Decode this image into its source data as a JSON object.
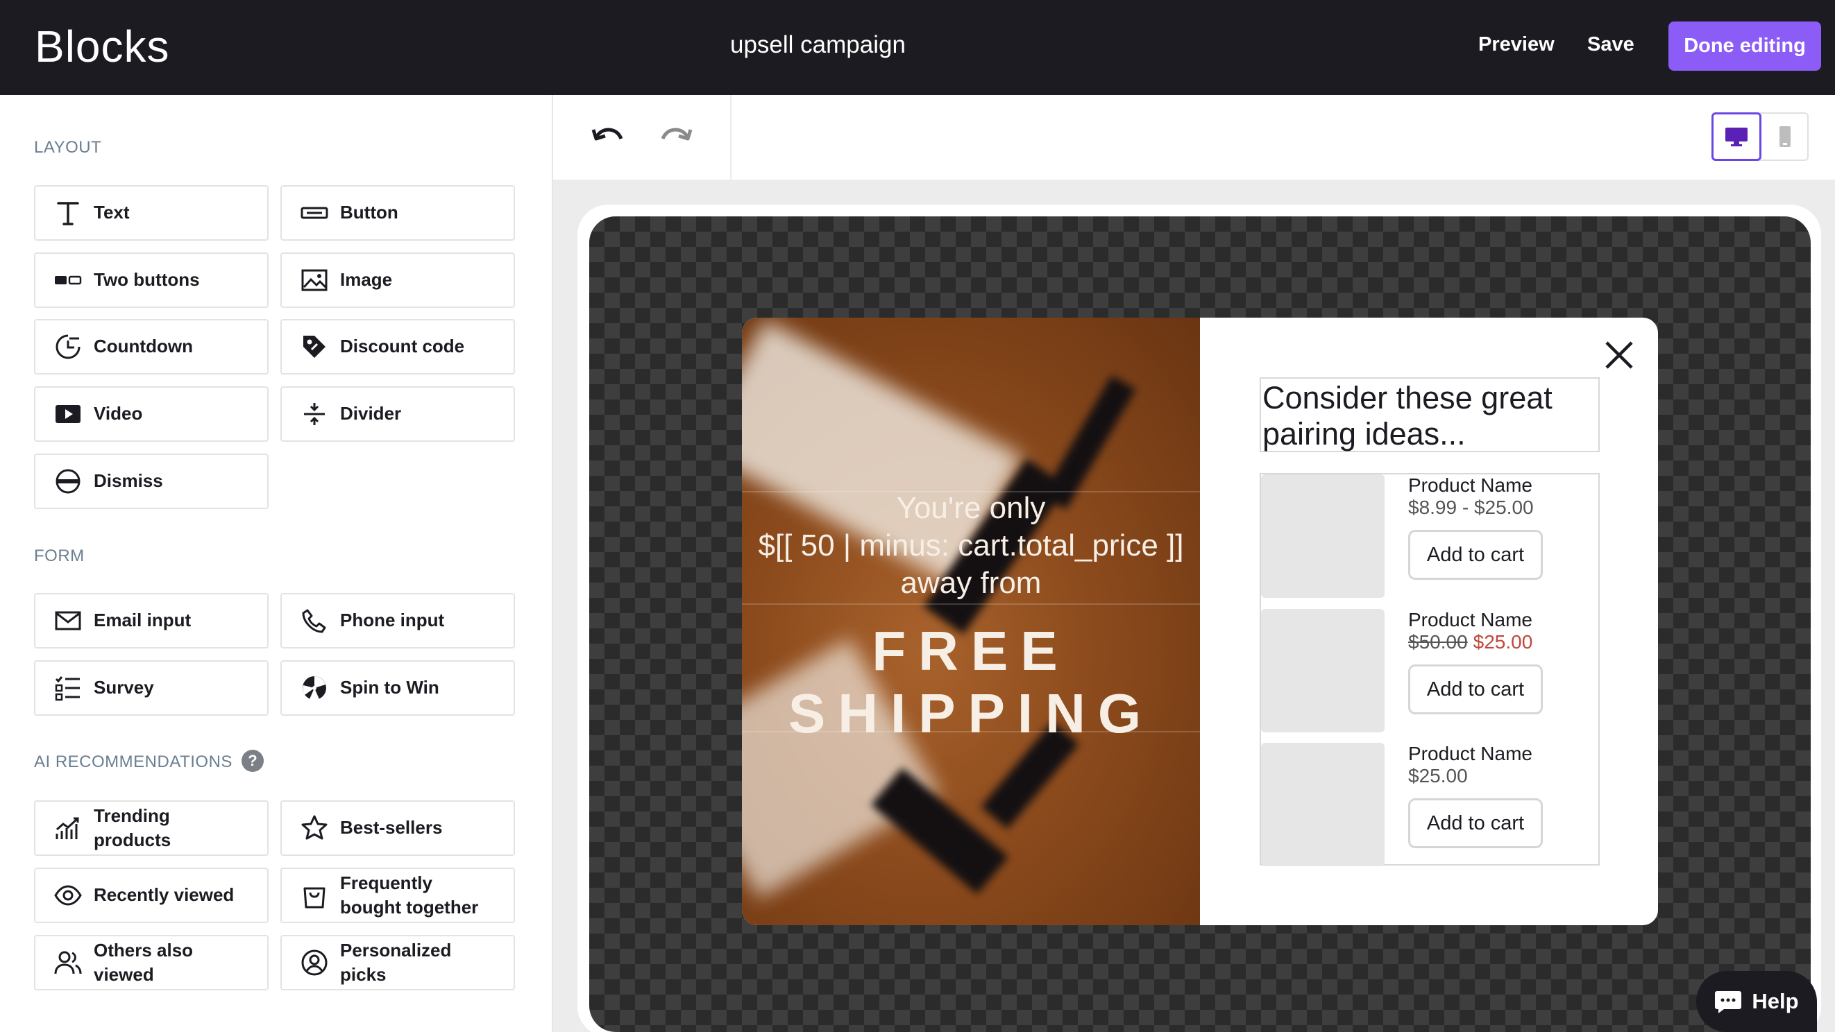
{
  "header": {
    "brand": "Blocks",
    "campaign_name": "upsell campaign",
    "preview_label": "Preview",
    "save_label": "Save",
    "done_label": "Done editing"
  },
  "sidebar": {
    "layout_title": "LAYOUT",
    "layout_blocks": [
      "Text",
      "Button",
      "Two buttons",
      "Image",
      "Countdown",
      "Discount code",
      "Video",
      "Divider",
      "Dismiss"
    ],
    "form_title": "FORM",
    "form_blocks": [
      "Email input",
      "Phone input",
      "Survey",
      "Spin to Win"
    ],
    "ai_title": "AI RECOMMENDATIONS",
    "ai_help": "?",
    "ai_blocks": [
      "Trending products",
      "Best-sellers",
      "Recently viewed",
      "Frequently bought together",
      "Others also viewed",
      "Personalized picks"
    ]
  },
  "toolbar": {
    "undo_icon": "undo-icon",
    "redo_icon": "redo-icon",
    "device_selected": "desktop"
  },
  "popup": {
    "hero_line1": "You're only",
    "hero_line2": "$[[ 50 | minus: cart.total_price ]]",
    "hero_line3": "away from",
    "hero_line4": "FREE",
    "hero_line5": "SHIPPING",
    "reco_title": "Consider these great pairing ideas...",
    "products": [
      {
        "name": "Product Name",
        "price": "$8.99 - $25.00",
        "button": "Add to cart"
      },
      {
        "name": "Product Name",
        "price_old": "$50.00",
        "price_sale": "$25.00",
        "button": "Add to cart"
      },
      {
        "name": "Product Name",
        "price": "$25.00",
        "button": "Add to cart"
      }
    ]
  },
  "help": {
    "label": "Help"
  },
  "colors": {
    "accent": "#8b5cf6",
    "topbar": "#1c1b22",
    "sale": "#c0473c"
  }
}
